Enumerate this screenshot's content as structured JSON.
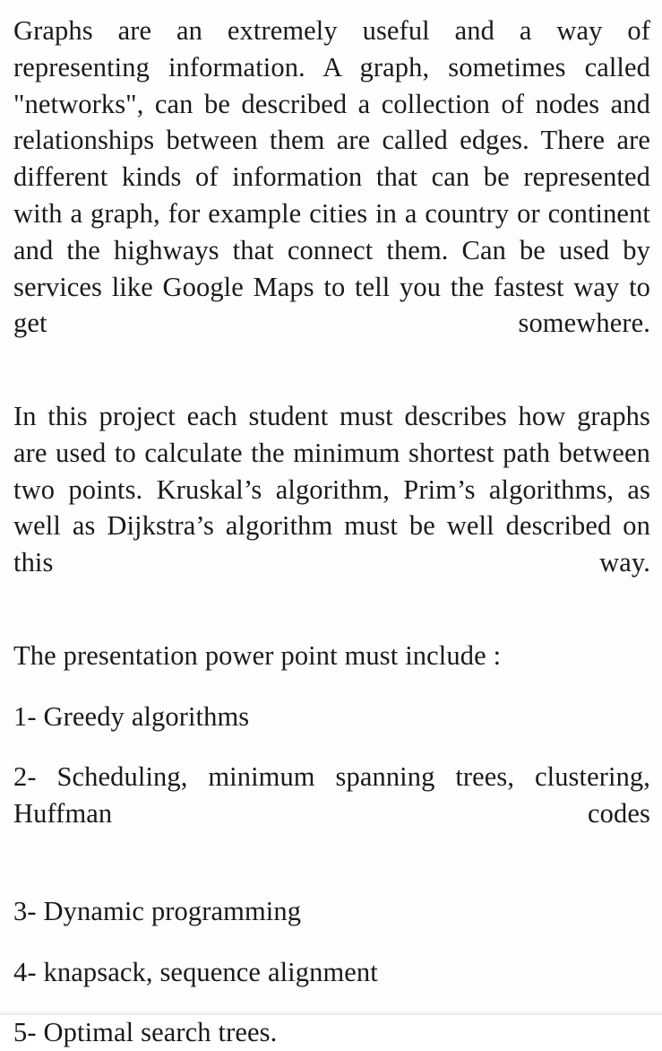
{
  "document": {
    "type": "project-assignment-text",
    "background_color": "#fefefe",
    "text_color": "#1a1a1a",
    "paragraphs": {
      "intro": "Graphs are an extremely useful and a way of representing information.  A graph, sometimes called \"networks\", can be described a collection of nodes and relationships between them are called edges. There are different kinds of information that can be represented with a graph, for example cities in a country or continent and the highways that connect them. Can be used by services like Google Maps to tell you the fastest way to get somewhere.",
      "project": "In this project each student must describes how graphs are used to calculate the minimum shortest path between two points. Kruskal’s algorithm, Prim’s algorithms, as well as Dijkstra’s algorithm must be well described on this way.",
      "requirements_heading": "The presentation power point must include :"
    },
    "list_items": [
      "1- Greedy algorithms",
      "2- Scheduling, minimum spanning trees, clustering, Huffman codes",
      "3- Dynamic programming",
      "4- knapsack, sequence alignment",
      "5- Optimal search trees."
    ]
  }
}
